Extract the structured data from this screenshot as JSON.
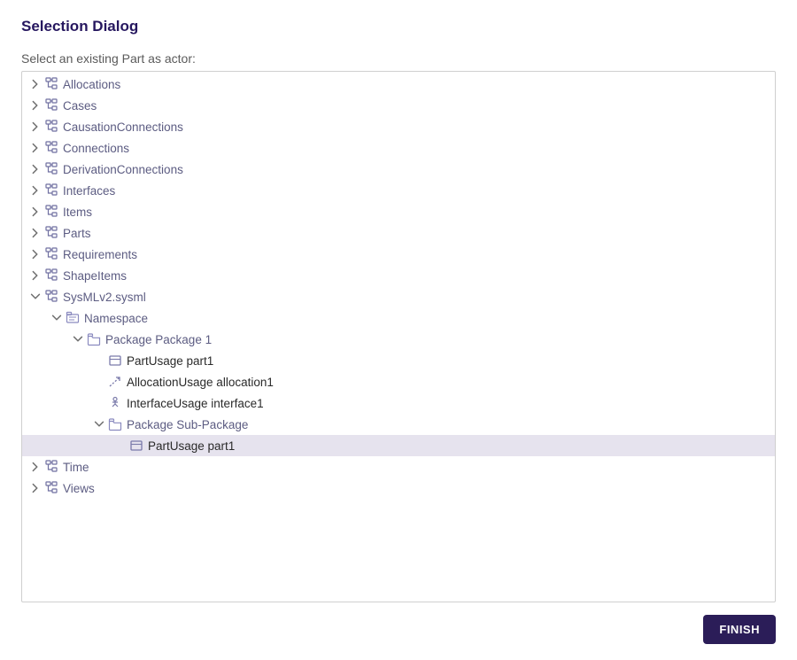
{
  "dialog": {
    "title": "Selection Dialog",
    "prompt": "Select an existing Part as actor:",
    "finish_label": "FINISH"
  },
  "tree": [
    {
      "id": "allocations",
      "label": "Allocations",
      "expanded": false,
      "depth": 0,
      "icon": "tree",
      "chev": "right"
    },
    {
      "id": "cases",
      "label": "Cases",
      "expanded": false,
      "depth": 0,
      "icon": "tree",
      "chev": "right"
    },
    {
      "id": "causation",
      "label": "CausationConnections",
      "expanded": false,
      "depth": 0,
      "icon": "tree",
      "chev": "right"
    },
    {
      "id": "connections",
      "label": "Connections",
      "expanded": false,
      "depth": 0,
      "icon": "tree",
      "chev": "right"
    },
    {
      "id": "derivation",
      "label": "DerivationConnections",
      "expanded": false,
      "depth": 0,
      "icon": "tree",
      "chev": "right"
    },
    {
      "id": "interfaces",
      "label": "Interfaces",
      "expanded": false,
      "depth": 0,
      "icon": "tree",
      "chev": "right"
    },
    {
      "id": "items",
      "label": "Items",
      "expanded": false,
      "depth": 0,
      "icon": "tree",
      "chev": "right"
    },
    {
      "id": "parts",
      "label": "Parts",
      "expanded": false,
      "depth": 0,
      "icon": "tree",
      "chev": "right"
    },
    {
      "id": "requirements",
      "label": "Requirements",
      "expanded": false,
      "depth": 0,
      "icon": "tree",
      "chev": "right"
    },
    {
      "id": "shapeitems",
      "label": "ShapeItems",
      "expanded": false,
      "depth": 0,
      "icon": "tree",
      "chev": "right"
    },
    {
      "id": "sysml",
      "label": "SysMLv2.sysml",
      "expanded": true,
      "depth": 0,
      "icon": "tree",
      "chev": "down"
    },
    {
      "id": "namespace",
      "label": "Namespace",
      "expanded": true,
      "depth": 1,
      "icon": "ns",
      "chev": "down"
    },
    {
      "id": "pkg1",
      "label": "Package Package 1",
      "expanded": true,
      "depth": 2,
      "icon": "folder",
      "chev": "down"
    },
    {
      "id": "part1",
      "label": "PartUsage part1",
      "expanded": false,
      "depth": 3,
      "icon": "part",
      "chev": "none",
      "dark": true
    },
    {
      "id": "alloc1",
      "label": "AllocationUsage allocation1",
      "expanded": false,
      "depth": 3,
      "icon": "alloc",
      "chev": "none",
      "dark": true
    },
    {
      "id": "iface1",
      "label": "InterfaceUsage interface1",
      "expanded": false,
      "depth": 3,
      "icon": "iface",
      "chev": "none",
      "dark": true
    },
    {
      "id": "subpkg",
      "label": "Package Sub-Package",
      "expanded": true,
      "depth": 3,
      "icon": "folder",
      "chev": "down"
    },
    {
      "id": "part1b",
      "label": "PartUsage part1",
      "expanded": false,
      "depth": 4,
      "icon": "part",
      "chev": "none",
      "dark": true,
      "selected": true
    },
    {
      "id": "time",
      "label": "Time",
      "expanded": false,
      "depth": 0,
      "icon": "tree",
      "chev": "right"
    },
    {
      "id": "views",
      "label": "Views",
      "expanded": false,
      "depth": 0,
      "icon": "tree",
      "chev": "right"
    }
  ],
  "icons": {
    "tree": "tree-icon",
    "ns": "namespace-icon",
    "folder": "folder-icon",
    "part": "part-icon",
    "alloc": "allocation-icon",
    "iface": "interface-icon"
  }
}
